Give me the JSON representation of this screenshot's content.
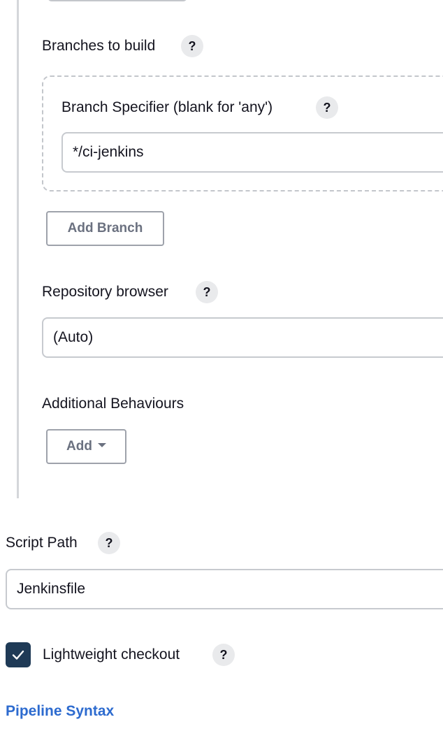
{
  "branches": {
    "label": "Branches to build",
    "help": "?",
    "branch_specifier": {
      "label": "Branch Specifier (blank for 'any')",
      "help": "?",
      "value": "*/ci-jenkins"
    },
    "add_branch_button": "Add Branch"
  },
  "repository_browser": {
    "label": "Repository browser",
    "help": "?",
    "selected": "(Auto)"
  },
  "additional_behaviours": {
    "label": "Additional Behaviours",
    "add_button": "Add"
  },
  "script_path": {
    "label": "Script Path",
    "help": "?",
    "value": "Jenkinsfile"
  },
  "lightweight_checkout": {
    "label": "Lightweight checkout",
    "help": "?",
    "checked": true
  },
  "pipeline_syntax_link": "Pipeline Syntax",
  "colors": {
    "checkbox": "#1f3a56",
    "link": "#2d6bcf"
  }
}
